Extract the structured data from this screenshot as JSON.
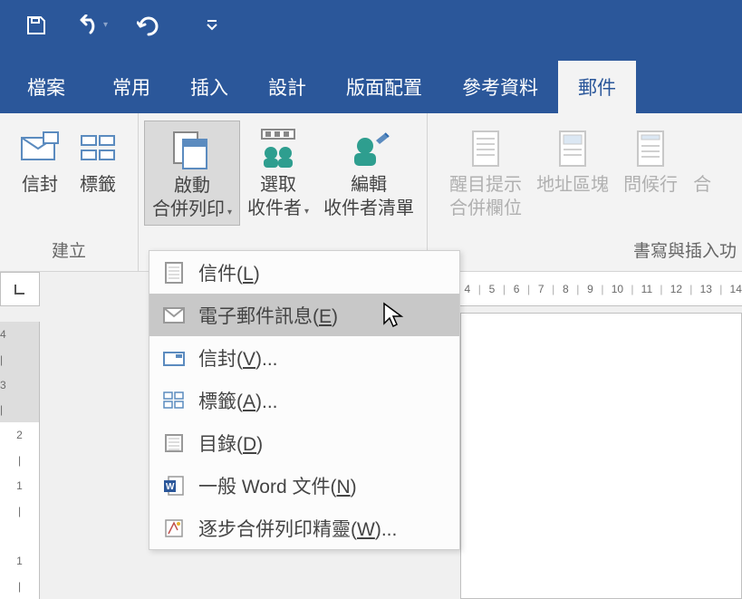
{
  "qat": {
    "save": "save",
    "undo": "undo",
    "redo": "redo"
  },
  "tabs": {
    "file": "檔案",
    "home": "常用",
    "insert": "插入",
    "design": "設計",
    "layout": "版面配置",
    "references": "參考資料",
    "mailings": "郵件"
  },
  "ribbon": {
    "create": {
      "envelope": "信封",
      "labels": "標籤",
      "group_label": "建立"
    },
    "start": {
      "start_merge_l1": "啟動",
      "start_merge_l2": "合併列印",
      "select_recip_l1": "選取",
      "select_recip_l2": "收件者",
      "edit_recip_l1": "編輯",
      "edit_recip_l2": "收件者清單"
    },
    "write": {
      "highlight_l1": "醒目提示",
      "highlight_l2": "合併欄位",
      "address_block": "地址區塊",
      "greeting_line": "問候行",
      "insert_merge_partial": "合",
      "group_label": "書寫與插入功"
    }
  },
  "dropdown": {
    "letters": {
      "text": "信件(",
      "key": "L",
      "suffix": ")"
    },
    "email": {
      "text": "電子郵件訊息(",
      "key": "E",
      "suffix": ")"
    },
    "envelopes": {
      "text": "信封(",
      "key": "V",
      "suffix": ")..."
    },
    "labels": {
      "text": "標籤(",
      "key": "A",
      "suffix": ")..."
    },
    "directory": {
      "text": "目錄(",
      "key": "D",
      "suffix": ")"
    },
    "normal": {
      "text": "一般 Word 文件(",
      "key": "N",
      "suffix": ")"
    },
    "wizard": {
      "text": "逐步合併列印精靈(",
      "key": "W",
      "suffix": ")..."
    }
  },
  "ruler": {
    "h": [
      "4",
      "|",
      "5",
      "|",
      "6",
      "|",
      "7",
      "|",
      "8",
      "|",
      "9",
      "|",
      "10",
      "|",
      "11",
      "|",
      "12",
      "|",
      "13",
      "|",
      "14"
    ],
    "v": [
      "4",
      "|",
      "3",
      "|",
      "2",
      "|",
      "1",
      "|",
      "",
      "1",
      "|"
    ]
  }
}
